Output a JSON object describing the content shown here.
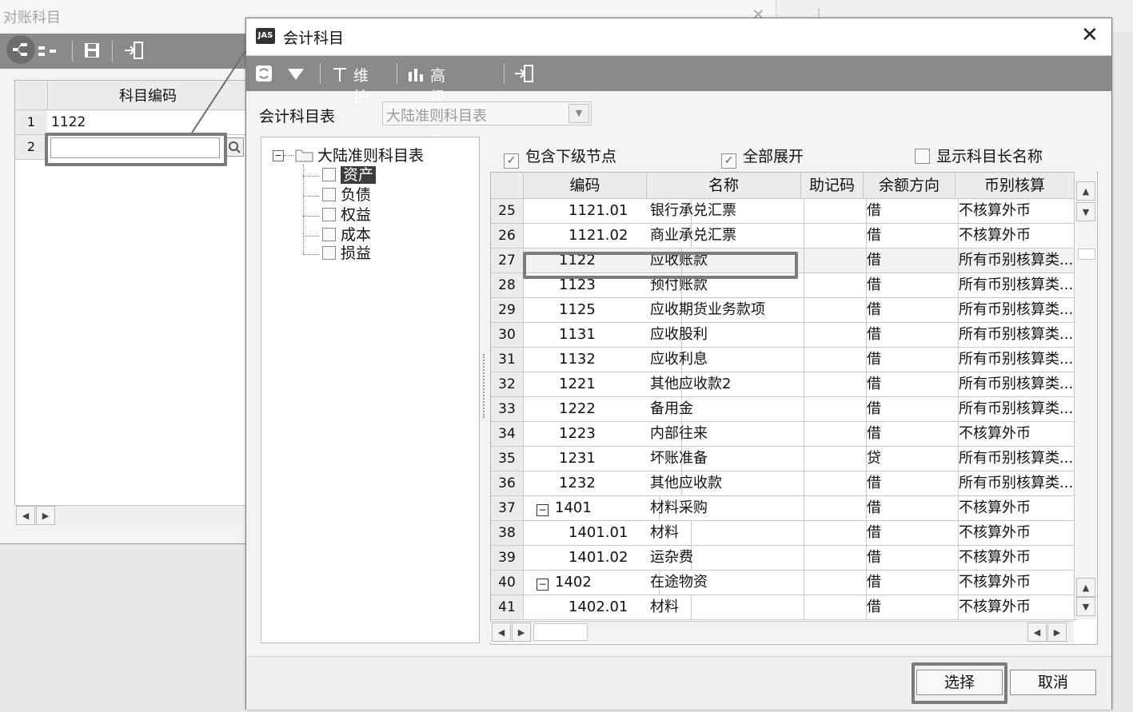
{
  "background_window": {
    "title": "对账科目",
    "close_glyph": "✕",
    "grid": {
      "header": "科目编码",
      "rows": [
        {
          "num": "1",
          "value": "1122"
        },
        {
          "num": "2",
          "value": ""
        }
      ]
    }
  },
  "dialog": {
    "logo_text": "JAS",
    "title": "会计科目",
    "close_glyph": "✕",
    "toolbar": {
      "maintain_label": "维护",
      "advanced_stats_label": "高级统计"
    },
    "table_label": "会计科目表",
    "table_select_value": "大陆准则科目表",
    "tree": {
      "root": "大陆准则科目表",
      "children": [
        "资产",
        "负债",
        "权益",
        "成本",
        "损益"
      ]
    },
    "options": {
      "include_children": "包含下级节点",
      "expand_all": "全部展开",
      "show_long_name": "显示科目长名称"
    },
    "grid": {
      "columns": [
        "编码",
        "名称",
        "助记码",
        "余额方向",
        "币别核算"
      ],
      "rows": [
        {
          "num": "25",
          "code": "1121.01",
          "name": "银行承兑汇票",
          "mnemonic": "",
          "direction": "借",
          "currency": "不核算外币"
        },
        {
          "num": "26",
          "code": "1121.02",
          "name": "商业承兑汇票",
          "mnemonic": "",
          "direction": "借",
          "currency": "不核算外币"
        },
        {
          "num": "27",
          "code": "1122",
          "name": "应收账款",
          "mnemonic": "",
          "direction": "借",
          "currency": "所有币别核算类..."
        },
        {
          "num": "28",
          "code": "1123",
          "name": "预付账款",
          "mnemonic": "",
          "direction": "借",
          "currency": "所有币别核算类..."
        },
        {
          "num": "29",
          "code": "1125",
          "name": "应收期货业务款项",
          "mnemonic": "",
          "direction": "借",
          "currency": "所有币别核算类..."
        },
        {
          "num": "30",
          "code": "1131",
          "name": "应收股利",
          "mnemonic": "",
          "direction": "借",
          "currency": "所有币别核算类..."
        },
        {
          "num": "31",
          "code": "1132",
          "name": "应收利息",
          "mnemonic": "",
          "direction": "借",
          "currency": "所有币别核算类..."
        },
        {
          "num": "32",
          "code": "1221",
          "name": "其他应收款2",
          "mnemonic": "",
          "direction": "借",
          "currency": "所有币别核算类..."
        },
        {
          "num": "33",
          "code": "1222",
          "name": "备用金",
          "mnemonic": "",
          "direction": "借",
          "currency": "所有币别核算类..."
        },
        {
          "num": "34",
          "code": "1223",
          "name": "内部往来",
          "mnemonic": "",
          "direction": "借",
          "currency": "不核算外币"
        },
        {
          "num": "35",
          "code": "1231",
          "name": "坏账准备",
          "mnemonic": "",
          "direction": "贷",
          "currency": "所有币别核算类..."
        },
        {
          "num": "36",
          "code": "1232",
          "name": "其他应收款",
          "mnemonic": "",
          "direction": "借",
          "currency": "所有币别核算类..."
        },
        {
          "num": "37",
          "code": "1401",
          "name": "材料采购",
          "mnemonic": "",
          "direction": "借",
          "currency": "不核算外币"
        },
        {
          "num": "38",
          "code": "1401.01",
          "name": "材料",
          "mnemonic": "",
          "direction": "借",
          "currency": "不核算外币"
        },
        {
          "num": "39",
          "code": "1401.02",
          "name": "运杂费",
          "mnemonic": "",
          "direction": "借",
          "currency": "不核算外币"
        },
        {
          "num": "40",
          "code": "1402",
          "name": "在途物资",
          "mnemonic": "",
          "direction": "借",
          "currency": "不核算外币"
        },
        {
          "num": "41",
          "code": "1402.01",
          "name": "材料",
          "mnemonic": "",
          "direction": "借",
          "currency": "不核算外币"
        }
      ]
    },
    "buttons": {
      "select": "选择",
      "cancel": "取消"
    }
  }
}
